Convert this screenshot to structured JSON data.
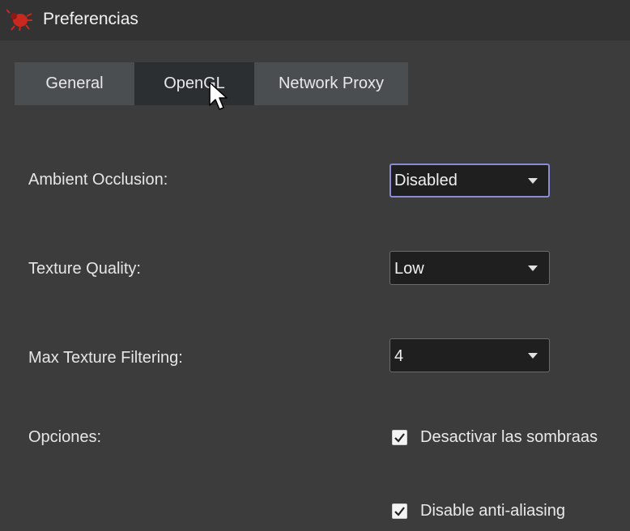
{
  "window": {
    "title": "Preferencias",
    "icon": "bug-icon"
  },
  "tabs": [
    {
      "label": "General",
      "active": false
    },
    {
      "label": "OpenGL",
      "active": true
    },
    {
      "label": "Network Proxy",
      "active": false
    }
  ],
  "opengl": {
    "ambient_occlusion": {
      "label": "Ambient Occlusion:",
      "value": "Disabled"
    },
    "texture_quality": {
      "label": "Texture Quality:",
      "value": "Low"
    },
    "max_texture_filtering": {
      "label": "Max Texture Filtering:",
      "value": "4"
    },
    "options": {
      "label": "Opciones:",
      "items": [
        {
          "label": "Desactivar las sombraas",
          "checked": true
        },
        {
          "label": "Disable anti-aliasing",
          "checked": true
        }
      ]
    }
  },
  "colors": {
    "background": "#3c3c3c",
    "titlebar": "#333333",
    "tab": "#4b4e51",
    "tab_active": "#2c2f32",
    "combo_bg": "#1f1f1f",
    "focus_border": "#8a8ad6"
  }
}
